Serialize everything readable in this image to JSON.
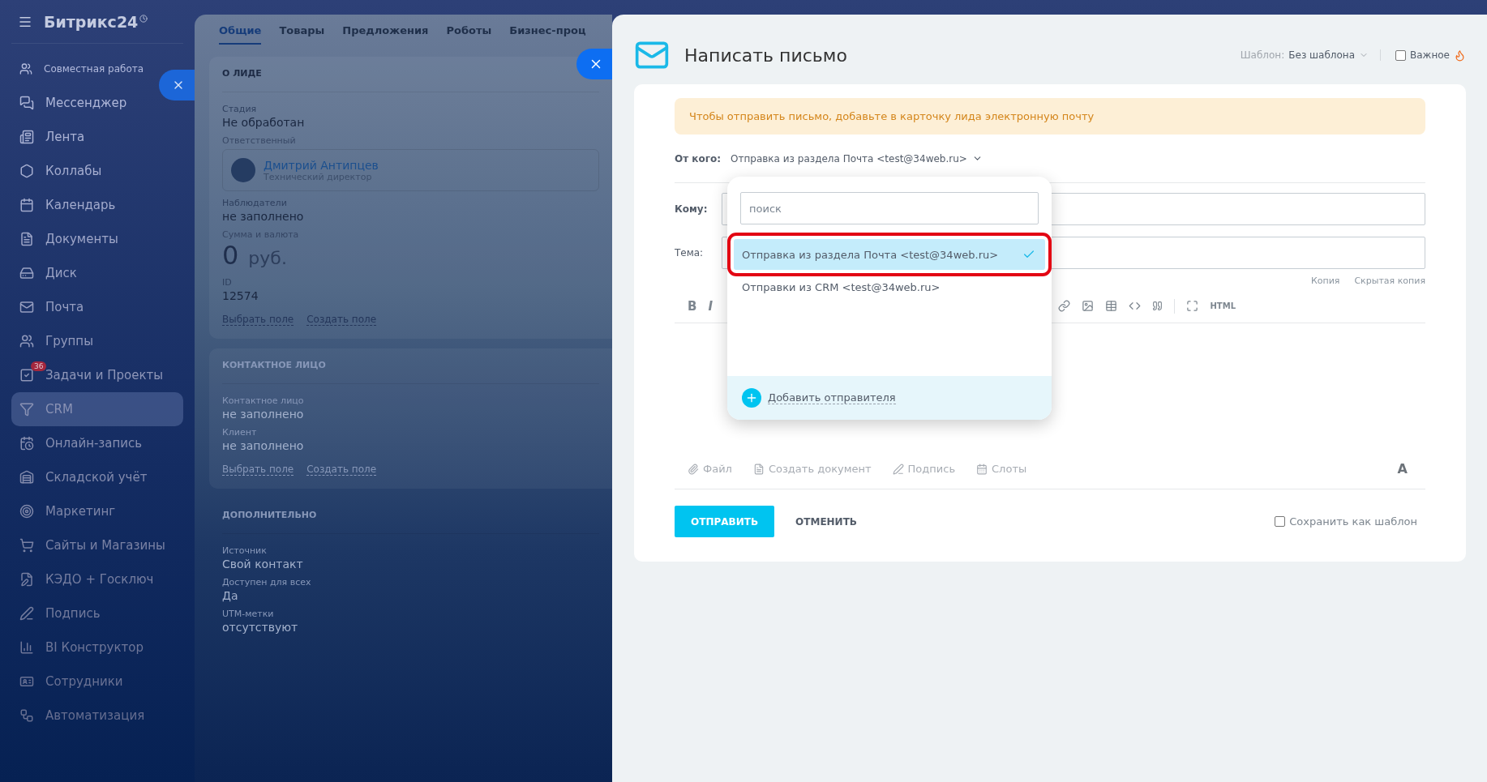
{
  "sidebar": {
    "logo": "Битрикс24",
    "items": [
      {
        "kind": "group",
        "label": "Совместная работа",
        "selected": false
      },
      {
        "kind": "item",
        "label": "Мессенджер",
        "selected": false
      },
      {
        "kind": "item",
        "label": "Лента",
        "selected": false
      },
      {
        "kind": "item",
        "label": "Коллабы",
        "selected": false
      },
      {
        "kind": "item",
        "label": "Календарь",
        "selected": false
      },
      {
        "kind": "item",
        "label": "Документы",
        "selected": false
      },
      {
        "kind": "item",
        "label": "Диск",
        "selected": false
      },
      {
        "kind": "item",
        "label": "Почта",
        "selected": false
      },
      {
        "kind": "item",
        "label": "Группы",
        "selected": false
      },
      {
        "kind": "item",
        "label": "Задачи и Проекты",
        "badge": "36",
        "selected": false
      },
      {
        "kind": "item",
        "label": "CRM",
        "selected": true
      },
      {
        "kind": "item",
        "label": "Онлайн-запись",
        "selected": false
      },
      {
        "kind": "item",
        "label": "Складской учёт",
        "selected": false
      },
      {
        "kind": "item",
        "label": "Маркетинг",
        "selected": false
      },
      {
        "kind": "item",
        "label": "Сайты и Магазины",
        "selected": false
      },
      {
        "kind": "item",
        "label": "КЭДО + Госключ",
        "selected": false
      },
      {
        "kind": "item",
        "label": "Подпись",
        "selected": false
      },
      {
        "kind": "item",
        "label": "BI Конструктор",
        "selected": false
      },
      {
        "kind": "item",
        "label": "Сотрудники",
        "selected": false
      },
      {
        "kind": "item",
        "label": "Автоматизация",
        "selected": false
      }
    ]
  },
  "lead": {
    "tabs": [
      {
        "label": "Общие",
        "selected": true
      },
      {
        "label": "Товары",
        "selected": false
      },
      {
        "label": "Предложения",
        "selected": false
      },
      {
        "label": "Роботы",
        "selected": false
      },
      {
        "label": "Бизнес-проц",
        "selected": false
      }
    ],
    "sections": [
      {
        "title": "О ЛИДЕ",
        "fields": [
          {
            "kind": "text",
            "label": "Стадия",
            "value": "Не обработан"
          },
          {
            "kind": "user",
            "label": "Ответственный",
            "name": "Дмитрий Антипцев",
            "position": "Технический директор"
          },
          {
            "kind": "text",
            "label": "Наблюдатели",
            "value": "не заполнено"
          },
          {
            "kind": "money",
            "label": "Сумма и валюта",
            "amount": "0",
            "currency": "руб."
          },
          {
            "kind": "text",
            "label": "ID",
            "value": "12574"
          }
        ],
        "links": [
          "Выбрать поле",
          "Создать поле"
        ]
      },
      {
        "title": "КОНТАКТНОЕ ЛИЦО",
        "fields": [
          {
            "kind": "text",
            "label": "Контактное лицо",
            "value": "не заполнено"
          },
          {
            "kind": "text",
            "label": "Клиент",
            "value": "не заполнено"
          }
        ],
        "links": [
          "Выбрать поле",
          "Создать поле"
        ]
      },
      {
        "title": "ДОПОЛНИТЕЛЬНО",
        "fields": [
          {
            "kind": "text",
            "label": "Источник",
            "value": "Свой контакт"
          },
          {
            "kind": "text",
            "label": "Доступен для всех",
            "value": "Да"
          },
          {
            "kind": "text",
            "label": "UTM-метки",
            "value": "отсутствуют"
          }
        ]
      }
    ]
  },
  "compose": {
    "title": "Написать письмо",
    "template_label": "Шаблон:",
    "template_value": "Без шаблона",
    "important": {
      "label": "Важное",
      "checked": false
    },
    "warning": "Чтобы отправить письмо, добавьте в карточку лида электронную почту",
    "from_label": "От кого:",
    "from_value": "Отправка из раздела Почта <test@34web.ru>",
    "to_label": "Кому:",
    "subject_label": "Тема:",
    "copy_links": [
      "Копия",
      "Скрытая копия"
    ],
    "toolbar": {
      "bold": "B",
      "italic": "I",
      "html": "HTML"
    },
    "attachments": [
      "Файл",
      "Создать документ",
      "Подпись",
      "Слоты"
    ],
    "font_button": "A",
    "send": "ОТПРАВИТЬ",
    "cancel": "ОТМЕНИТЬ",
    "save_template": {
      "label": "Сохранить как шаблон",
      "checked": false
    }
  },
  "sender_dropdown": {
    "search_placeholder": "поиск",
    "options": [
      {
        "label": "Отправка из раздела Почта <test@34web.ru>",
        "selected": true
      },
      {
        "label": "Отправки из CRM <test@34web.ru>",
        "selected": false
      }
    ],
    "add_label": "Добавить отправителя"
  }
}
